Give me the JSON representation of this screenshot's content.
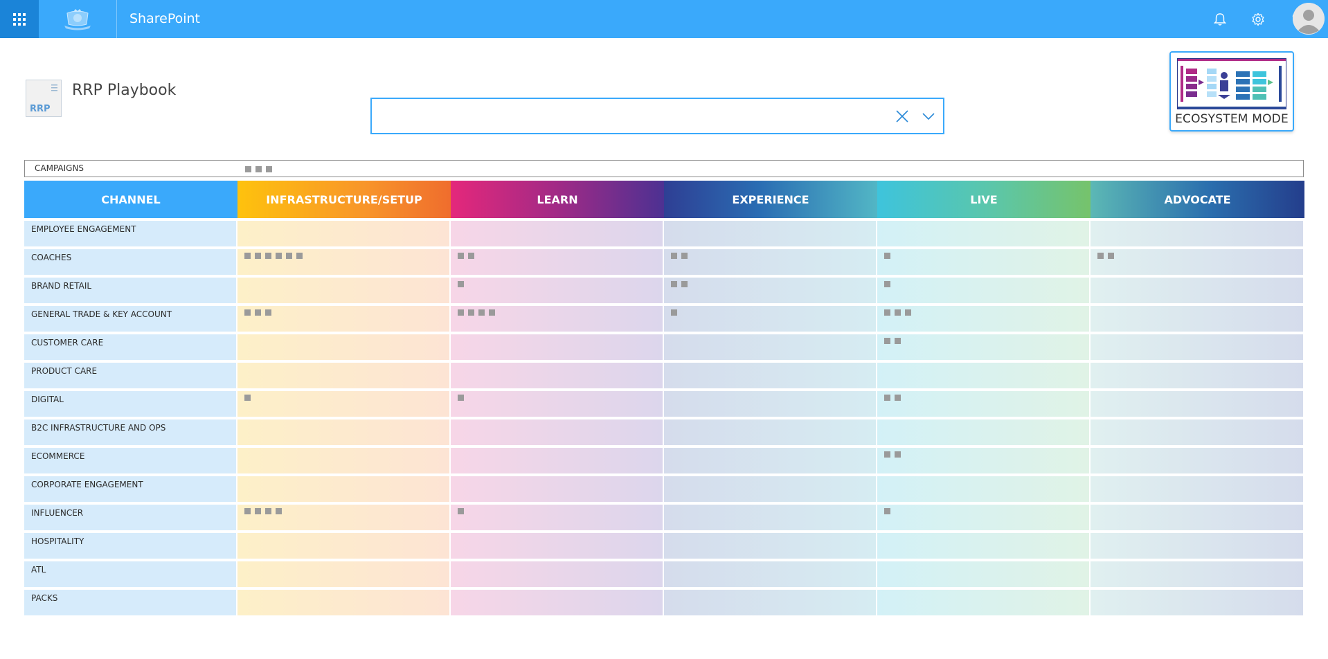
{
  "suite": {
    "app_name": "SharePoint",
    "icons": [
      "waffle-icon",
      "bell-icon",
      "gear-icon",
      "help-icon",
      "avatar-icon"
    ]
  },
  "site": {
    "logo_text": "RRP",
    "title": "RRP Playbook"
  },
  "search": {
    "value": "",
    "placeholder": ""
  },
  "ecosystem_button": {
    "label": "ECOSYSTEM MODE"
  },
  "campaigns": {
    "label": "CAMPAIGNS",
    "item_count": 3
  },
  "columns": [
    {
      "key": "channel",
      "label": "CHANNEL"
    },
    {
      "key": "infra",
      "label": "INFRASTRUCTURE/SETUP"
    },
    {
      "key": "learn",
      "label": "LEARN"
    },
    {
      "key": "exp",
      "label": "EXPERIENCE"
    },
    {
      "key": "live",
      "label": "LIVE"
    },
    {
      "key": "adv",
      "label": "ADVOCATE"
    }
  ],
  "rows": [
    {
      "channel": "EMPLOYEE ENGAGEMENT",
      "counts": [
        0,
        0,
        0,
        0,
        0
      ]
    },
    {
      "channel": "COACHES",
      "counts": [
        6,
        2,
        2,
        1,
        2
      ]
    },
    {
      "channel": "BRAND RETAIL",
      "counts": [
        0,
        1,
        2,
        1,
        0
      ]
    },
    {
      "channel": "GENERAL TRADE & KEY ACCOUNT",
      "counts": [
        3,
        4,
        1,
        3,
        0
      ]
    },
    {
      "channel": "CUSTOMER CARE",
      "counts": [
        0,
        0,
        0,
        2,
        0
      ]
    },
    {
      "channel": "PRODUCT CARE",
      "counts": [
        0,
        0,
        0,
        0,
        0
      ]
    },
    {
      "channel": "DIGITAL",
      "counts": [
        1,
        1,
        0,
        2,
        0
      ]
    },
    {
      "channel": "B2C INFRASTRUCTURE AND OPS",
      "counts": [
        0,
        0,
        0,
        0,
        0
      ]
    },
    {
      "channel": "ECOMMERCE",
      "counts": [
        0,
        0,
        0,
        2,
        0
      ]
    },
    {
      "channel": "CORPORATE ENGAGEMENT",
      "counts": [
        0,
        0,
        0,
        0,
        0
      ]
    },
    {
      "channel": "INFLUENCER",
      "counts": [
        4,
        1,
        0,
        1,
        0
      ]
    },
    {
      "channel": "HOSPITALITY",
      "counts": [
        0,
        0,
        0,
        0,
        0
      ]
    },
    {
      "channel": "ATL",
      "counts": [
        0,
        0,
        0,
        0,
        0
      ]
    },
    {
      "channel": "PACKS",
      "counts": [
        0,
        0,
        0,
        0,
        0
      ]
    }
  ]
}
